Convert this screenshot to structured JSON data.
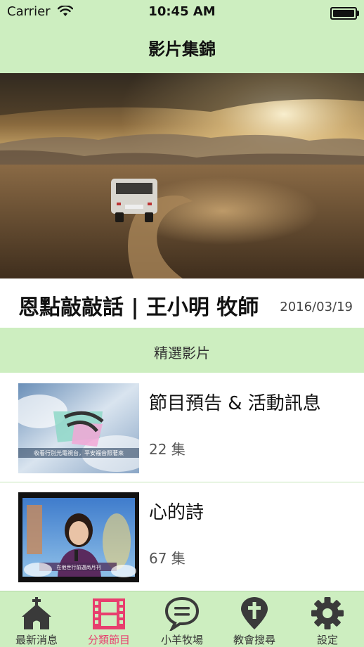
{
  "status_bar": {
    "carrier": "Carrier",
    "time": "10:45 AM"
  },
  "nav": {
    "title": "影片集錦"
  },
  "hero": {
    "title": "恩點敲敲話 | 王小明 牧師",
    "date": "2016/03/19"
  },
  "section": {
    "title": "精選影片"
  },
  "items": [
    {
      "title": "節目預告 & 活動訊息",
      "count": "22 集",
      "thumb_caption": "收看行別光電視台，平安福音照著來"
    },
    {
      "title": "心的詩",
      "count": "67 集",
      "thumb_caption": "在他世行前迦尚月刊"
    }
  ],
  "tabbar": {
    "tabs": [
      {
        "label": "最新消息",
        "icon": "church-icon"
      },
      {
        "label": "分類節目",
        "icon": "film-icon",
        "active": true
      },
      {
        "label": "小羊牧場",
        "icon": "chat-bubble-icon"
      },
      {
        "label": "教會搜尋",
        "icon": "map-pin-cross-icon"
      },
      {
        "label": "設定",
        "icon": "gear-icon"
      }
    ]
  },
  "colors": {
    "accent_green": "#cdeec0",
    "active_tab": "#e83e6e",
    "inactive_icon": "#3a3a3a"
  }
}
